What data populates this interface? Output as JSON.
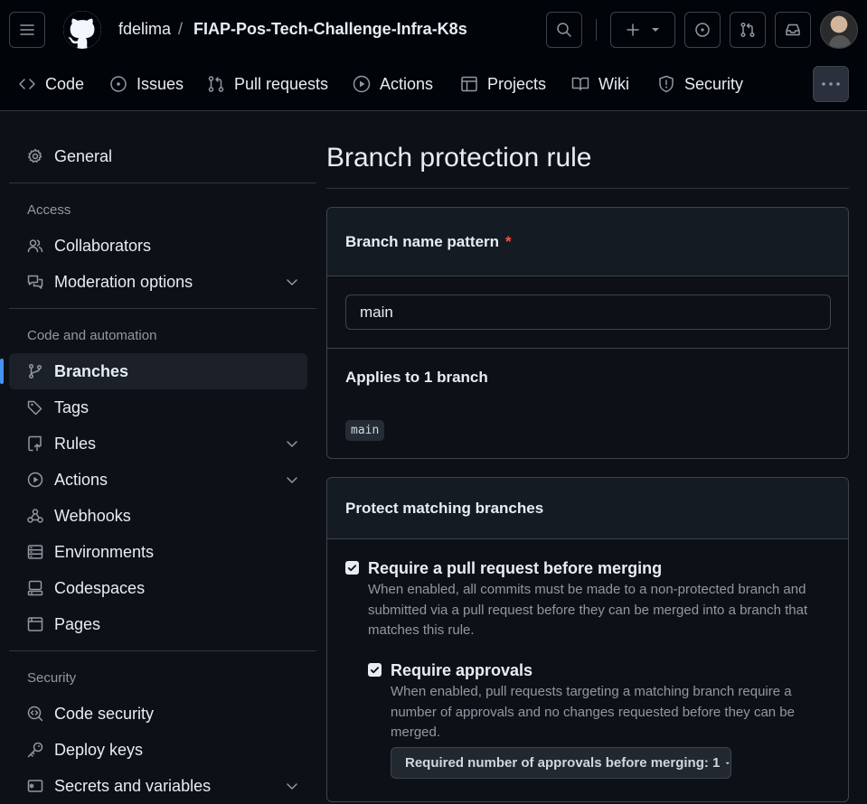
{
  "header": {
    "owner": "fdelima",
    "separator": "/",
    "repo": "FIAP-Pos-Tech-Challenge-Infra-K8s"
  },
  "nav": {
    "items": [
      {
        "label": "Code",
        "icon": "code-icon"
      },
      {
        "label": "Issues",
        "icon": "issue-icon"
      },
      {
        "label": "Pull requests",
        "icon": "pull-request-icon"
      },
      {
        "label": "Actions",
        "icon": "play-icon"
      },
      {
        "label": "Projects",
        "icon": "table-icon"
      },
      {
        "label": "Wiki",
        "icon": "book-icon"
      },
      {
        "label": "Security",
        "icon": "shield-icon"
      }
    ]
  },
  "sidebar": {
    "general": "General",
    "sections": [
      {
        "heading": "Access",
        "items": [
          "Collaborators",
          "Moderation options"
        ]
      },
      {
        "heading": "Code and automation",
        "items": [
          "Branches",
          "Tags",
          "Rules",
          "Actions",
          "Webhooks",
          "Environments",
          "Codespaces",
          "Pages"
        ]
      },
      {
        "heading": "Security",
        "items": [
          "Code security",
          "Deploy keys",
          "Secrets and variables"
        ]
      }
    ],
    "active": "Branches"
  },
  "main": {
    "title": "Branch protection rule",
    "pattern_label": "Branch name pattern",
    "required_mark": "*",
    "pattern_value": "main",
    "applies_text": "Applies to 1 branch",
    "matched_branch": "main",
    "protect_heading": "Protect matching branches",
    "rules": [
      {
        "title": "Require a pull request before merging",
        "checked": true,
        "desc": "When enabled, all commits must be made to a non-protected branch and submitted via a pull request before they can be merged into a branch that matches this rule."
      },
      {
        "title": "Require approvals",
        "checked": true,
        "desc": "When enabled, pull requests targeting a matching branch require a number of approvals and no changes requested before they can be merged."
      }
    ],
    "approvals_select": "Required number of approvals before merging: 1"
  },
  "colors": {
    "background": "#0d1117",
    "header": "#010409",
    "accent": "#4493f8",
    "danger": "#f85149"
  }
}
